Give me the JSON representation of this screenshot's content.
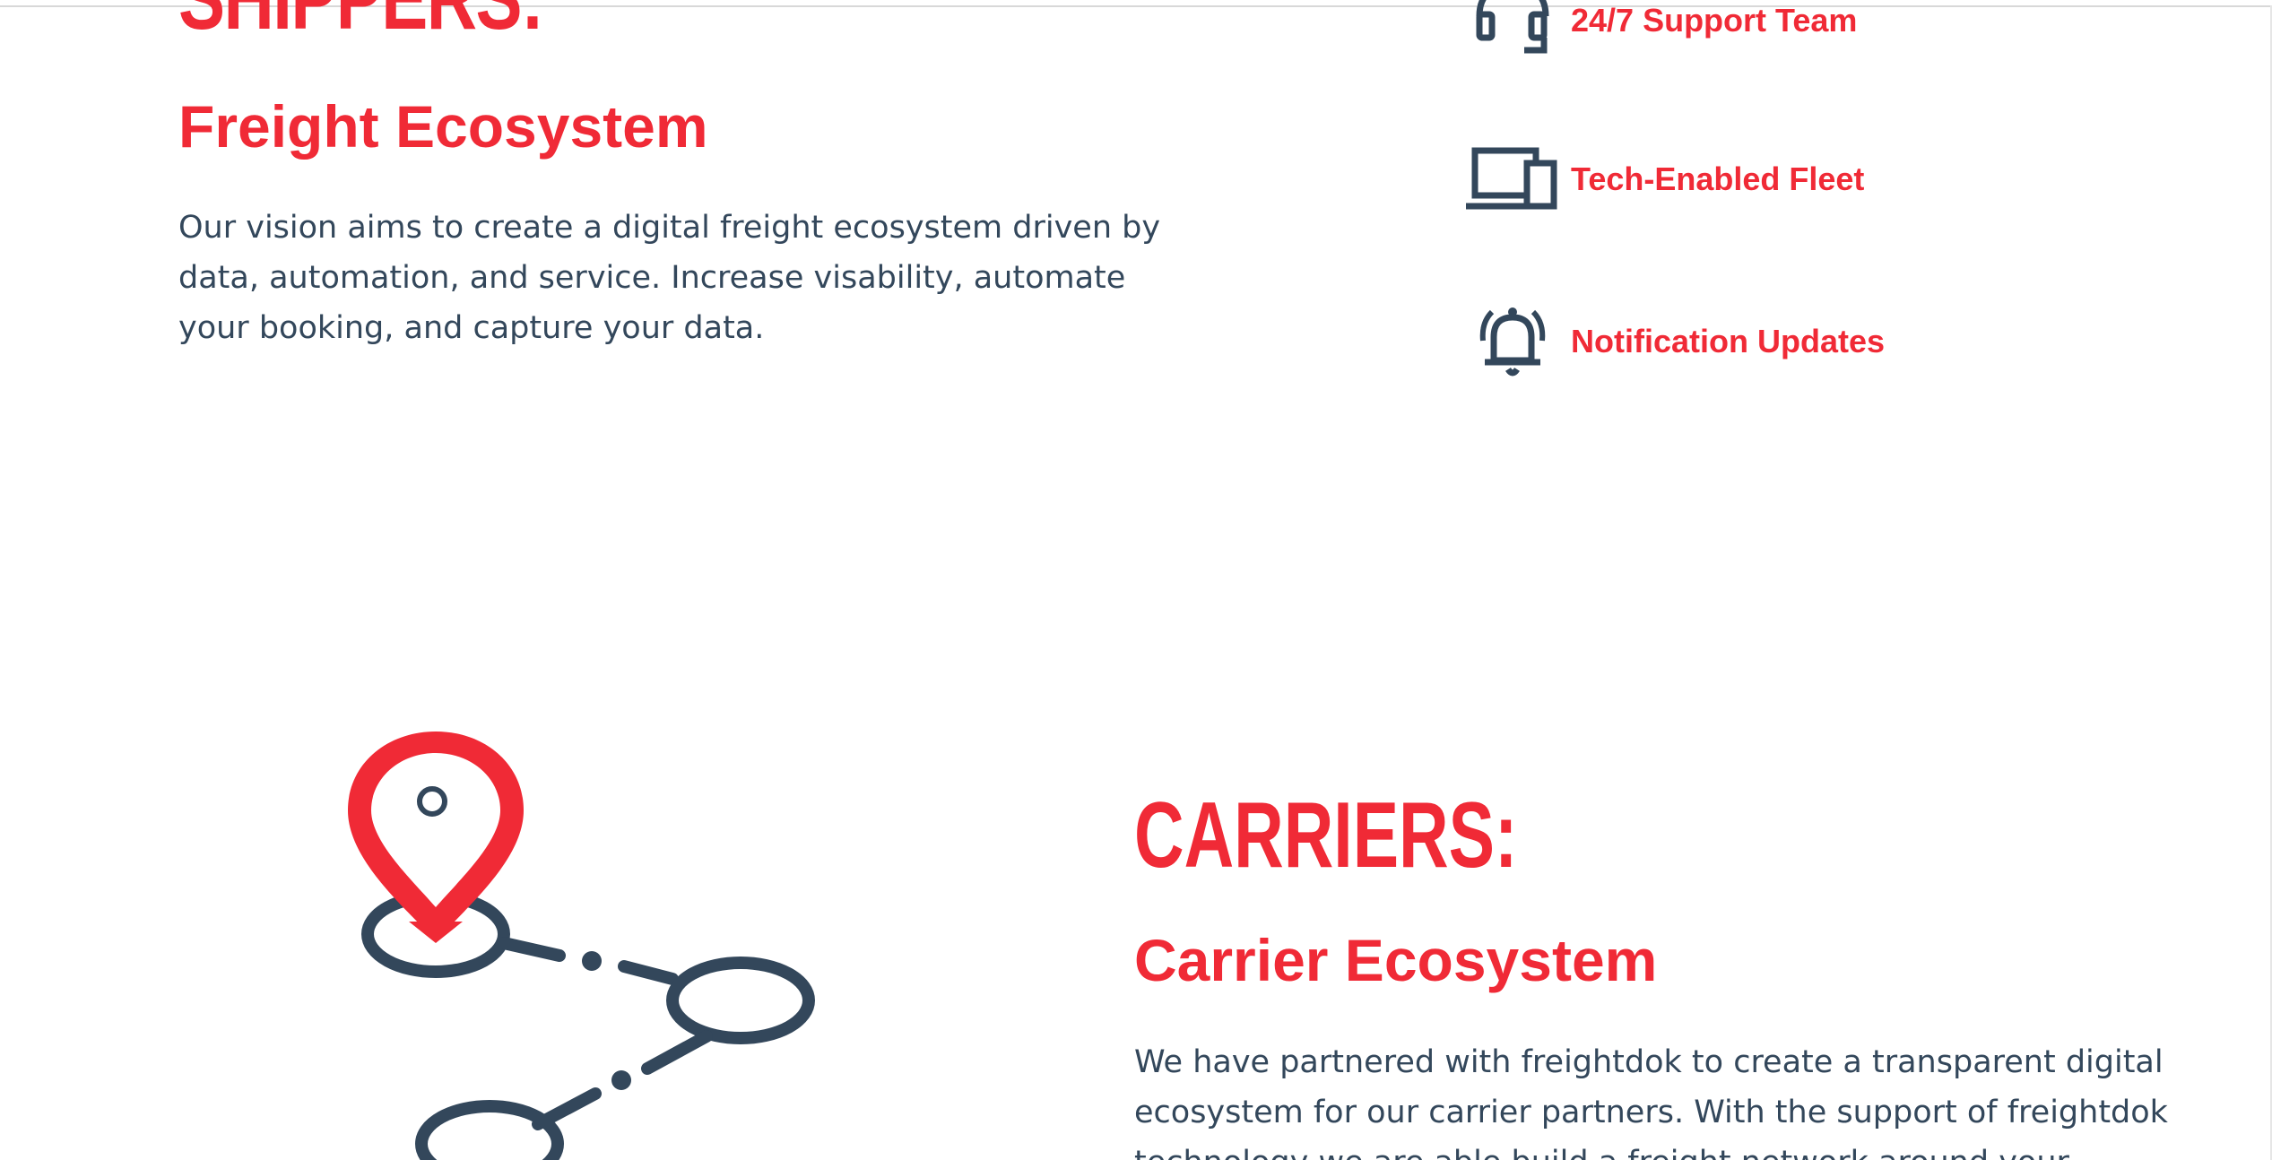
{
  "shippers": {
    "heading": "SHIPPERS:",
    "subheading": "Freight Ecosystem",
    "description": "Our vision aims to create a digital freight ecosystem driven by data, automation, and service. Increase visability, automate your booking, and capture your data."
  },
  "features": [
    {
      "icon": "headset-icon",
      "label": "24/7 Support Team"
    },
    {
      "icon": "devices-icon",
      "label": "Tech-Enabled Fleet"
    },
    {
      "icon": "bell-icon",
      "label": "Notification Updates"
    }
  ],
  "carriers": {
    "heading": "CARRIERS:",
    "subheading": "Carrier Ecosystem",
    "description": "We have partnered with freightdok to create a transparent digital ecosystem for our carrier partners. With the support of freightdok technology we are able build a freight network around your"
  },
  "colors": {
    "accent": "#f02a36",
    "text": "#33475b"
  }
}
